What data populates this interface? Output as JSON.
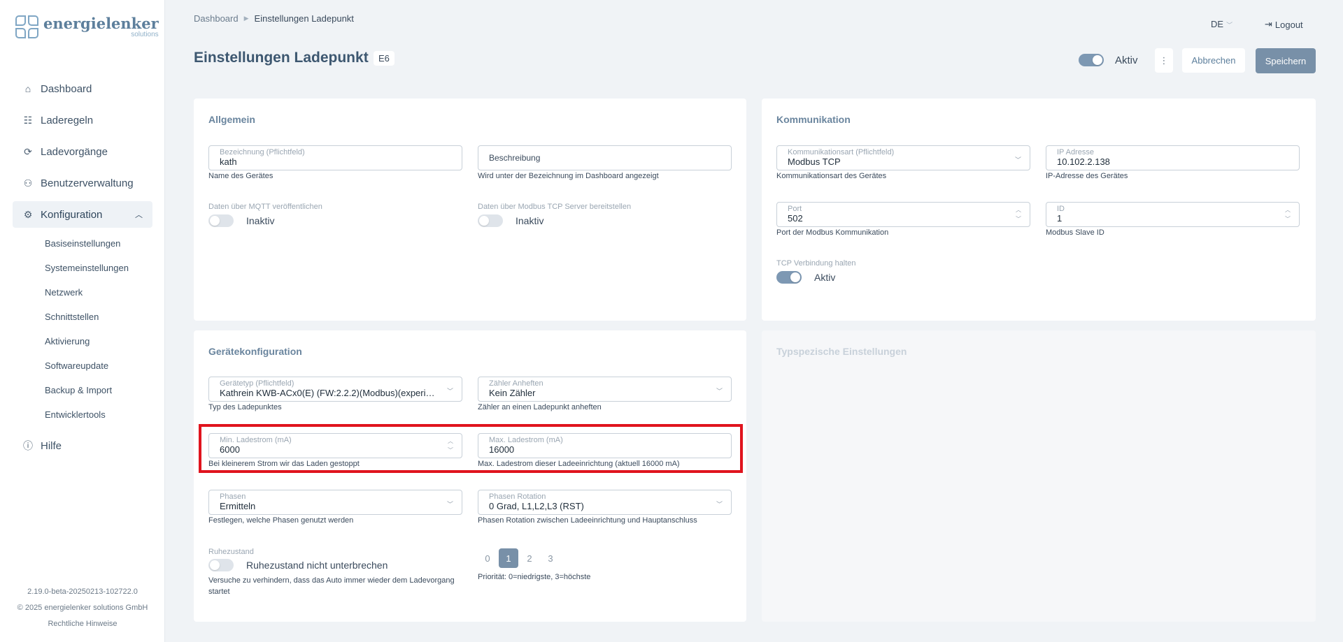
{
  "brand": {
    "name": "energielenker",
    "sub": "solutions"
  },
  "sidebar": {
    "items": [
      {
        "label": "Dashboard",
        "icon": "home-icon"
      },
      {
        "label": "Laderegeln",
        "icon": "rules-icon"
      },
      {
        "label": "Ladevorgänge",
        "icon": "charging-icon"
      },
      {
        "label": "Benutzerverwaltung",
        "icon": "users-icon"
      },
      {
        "label": "Konfiguration",
        "icon": "gear-icon"
      }
    ],
    "subitems": [
      "Basiseinstellungen",
      "Systemeinstellungen",
      "Netzwerk",
      "Schnittstellen",
      "Aktivierung",
      "Softwareupdate",
      "Backup & Import",
      "Entwicklertools"
    ],
    "help_label": "Hilfe",
    "version": "2.19.0-beta-20250213-102722.0",
    "copyright": "© 2025 energielenker solutions GmbH",
    "legal": "Rechtliche Hinweise"
  },
  "header": {
    "breadcrumb_home": "Dashboard",
    "breadcrumb_current": "Einstellungen Ladepunkt",
    "lang": "DE",
    "logout": "Logout",
    "title": "Einstellungen Ladepunkt",
    "badge": "E6",
    "active_label": "Aktiv",
    "active": true,
    "cancel": "Abbrechen",
    "save": "Speichern"
  },
  "general": {
    "title": "Allgemein",
    "name_label": "Bezeichnung (Pflichtfeld)",
    "name_value": "kath",
    "name_help": "Name des Gerätes",
    "desc_placeholder": "Beschreibung",
    "desc_help": "Wird unter der Bezeichnung im Dashboard angezeigt",
    "mqtt_label": "Daten über MQTT veröffentlichen",
    "mqtt_state": "Inaktiv",
    "modbus_label": "Daten über Modbus TCP Server bereitstellen",
    "modbus_state": "Inaktiv"
  },
  "communication": {
    "title": "Kommunikation",
    "type_label": "Kommunikationsart (Pflichtfeld)",
    "type_value": "Modbus TCP",
    "type_help": "Kommunikationsart des Gerätes",
    "ip_label": "IP Adresse",
    "ip_value": "10.102.2.138",
    "ip_help": "IP-Adresse des Gerätes",
    "port_label": "Port",
    "port_value": "502",
    "port_help": "Port der Modbus Kommunikation",
    "id_label": "ID",
    "id_value": "1",
    "id_help": "Modbus Slave ID",
    "tcp_label": "TCP Verbindung halten",
    "tcp_state": "Aktiv"
  },
  "device": {
    "title": "Gerätekonfiguration",
    "type_label": "Gerätetyp (Pflichtfeld)",
    "type_value": "Kathrein KWB-ACx0(E) (FW:2.2.2)(Modbus)(experimental)",
    "type_help": "Typ des Ladepunktes",
    "meter_label": "Zähler Anheften",
    "meter_value": "Kein Zähler",
    "meter_help": "Zähler an einen Ladepunkt anheften",
    "min_label": "Min. Ladestrom (mA)",
    "min_value": "6000",
    "min_help": "Bei kleinerem Strom wir das Laden gestoppt",
    "max_label": "Max. Ladestrom (mA)",
    "max_value": "16000",
    "max_help": "Max. Ladestrom dieser Ladeeinrichtung (aktuell 16000 mA)",
    "phases_label": "Phasen",
    "phases_value": "Ermitteln",
    "phases_help": "Festlegen, welche Phasen genutzt werden",
    "rotation_label": "Phasen Rotation",
    "rotation_value": "0 Grad, L1,L2,L3 (RST)",
    "rotation_help": "Phasen Rotation zwischen Ladeeinrichtung und Hauptanschluss",
    "idle_label": "Ruhezustand",
    "idle_state": "Ruhezustand nicht unterbrechen",
    "idle_help_1": "Versuche zu verhindern, dass das Auto immer wieder dem Ladevorgang",
    "idle_help_2": "startet",
    "priority_options": [
      "0",
      "1",
      "2",
      "3"
    ],
    "priority_selected": "1",
    "priority_help": "Priorität: 0=niedrigste, 3=höchste"
  },
  "typespecific": {
    "title": "Typspezische Einstellungen"
  },
  "colors": {
    "accent": "#7890a8",
    "highlight": "#e0141e",
    "title": "#3d5770"
  }
}
